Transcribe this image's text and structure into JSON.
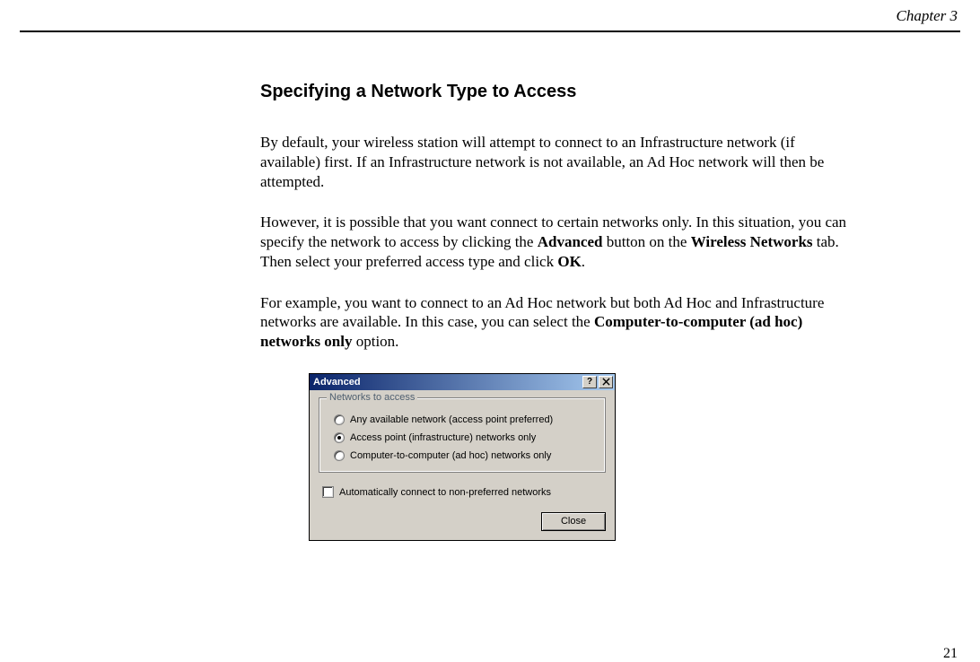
{
  "chapter": "Chapter 3",
  "heading": "Specifying a Network Type to Access",
  "para1": "By default, your wireless station will attempt to connect to an Infrastructure network (if available) first. If an Infrastructure network is not available, an Ad Hoc network will then be attempted.",
  "para2_a": "However, it is possible that you want connect to certain networks only. In this situation, you can specify the network to access by clicking the ",
  "para2_b": "Advanced",
  "para2_c": " button on the ",
  "para2_d": "Wireless Networks",
  "para2_e": " tab. Then select your preferred access type and click ",
  "para2_f": "OK",
  "para2_g": ".",
  "para3_a": "For example, you want to connect to an Ad Hoc network but both Ad Hoc and Infrastructure networks are available. In this case, you can select the ",
  "para3_b": "Computer-to-computer (ad hoc) networks only",
  "para3_c": " option.",
  "page_number": "21",
  "dialog": {
    "title": "Advanced",
    "group_legend": "Networks to access",
    "option1": "Any available network (access point preferred)",
    "option2": "Access point (infrastructure) networks only",
    "option3": "Computer-to-computer (ad hoc) networks only",
    "auto_connect": "Automatically connect to non-preferred networks",
    "close_button": "Close"
  }
}
